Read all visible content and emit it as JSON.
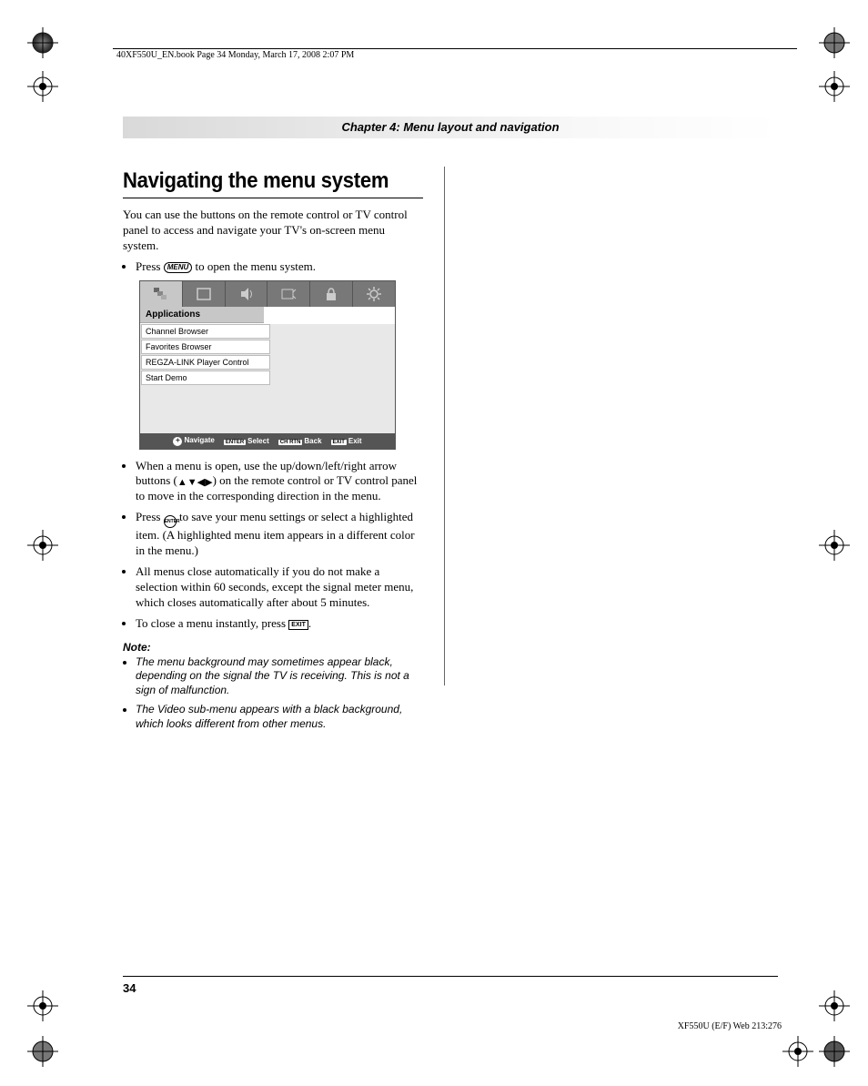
{
  "header_runner": "40XF550U_EN.book  Page 34  Monday, March 17, 2008  2:07 PM",
  "chapter_title": "Chapter 4: Menu layout and navigation",
  "section_title": "Navigating the menu system",
  "intro": "You can use the buttons on the remote control or TV control panel to access and navigate your TV's on-screen menu system.",
  "bullet1_a": "Press ",
  "bullet1_key": "MENU",
  "bullet1_b": " to open the menu system.",
  "osd": {
    "header_label": "Applications",
    "items": [
      "Channel Browser",
      "Favorites Browser",
      "REGZA-LINK Player Control",
      "Start Demo"
    ],
    "footer": {
      "navigate": "Navigate",
      "enter_box": "ENTER",
      "select": "Select",
      "chrtn_box": "CH RTN",
      "back": "Back",
      "exit_box": "EXIT",
      "exit": "Exit"
    }
  },
  "bullet2_a": "When a menu is open, use the up/down/left/right arrow buttons (",
  "bullet2_b": ") on the remote control or TV control panel to move in the corresponding direction in the menu.",
  "bullet3_a": "Press ",
  "bullet3_key": "ENTER",
  "bullet3_b": " to save your menu settings or select a highlighted item. (A highlighted menu item appears in a different color in the menu.)",
  "bullet4": "All menus close automatically if you do not make a selection within 60 seconds, except the signal meter menu, which closes automatically after about 5 minutes.",
  "bullet5_a": "To close a menu instantly, press ",
  "bullet5_key": "EXIT",
  "bullet5_b": ".",
  "note_heading": "Note:",
  "note1": "The menu background may sometimes appear black, depending on the signal the TV is receiving. This is not a sign of malfunction.",
  "note2": "The Video sub-menu appears with a black background, which looks different from other menus.",
  "page_number": "34",
  "footer_right": "XF550U (E/F) Web 213:276"
}
